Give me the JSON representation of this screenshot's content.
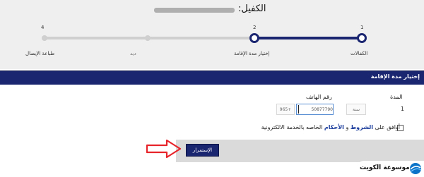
{
  "header": {
    "sponsor_label": "الكفيل:"
  },
  "steps": [
    {
      "number": "1",
      "label": "الكفالات",
      "state": "complete"
    },
    {
      "number": "2",
      "label": "إختيار مدة الإقامة",
      "state": "current"
    },
    {
      "number": "",
      "label": "ديد",
      "state": "pending"
    },
    {
      "number": "4",
      "label": "طباعة الإيصال",
      "state": "pending"
    }
  ],
  "panel": {
    "title": "إختيار مدة الإقامة"
  },
  "form": {
    "duration_label": "المدة",
    "duration_value": "1",
    "duration_unit": "سنة",
    "phone_label": "رقم الهاتف",
    "phone_value": "50877790",
    "country_code": "+965"
  },
  "agreement": {
    "prefix": "أوافق على ",
    "terms": "الشروط",
    "conjunction": " و ",
    "conditions": "الأحكام",
    "suffix": " الخاصه بالخدمة الالكترونية"
  },
  "actions": {
    "continue_label": "الإستمرار"
  },
  "watermark": {
    "text": "موسوعة الكويت"
  },
  "colors": {
    "primary": "#1b2670",
    "track_pending": "#cfcfcf",
    "link": "#1b3c9c"
  }
}
